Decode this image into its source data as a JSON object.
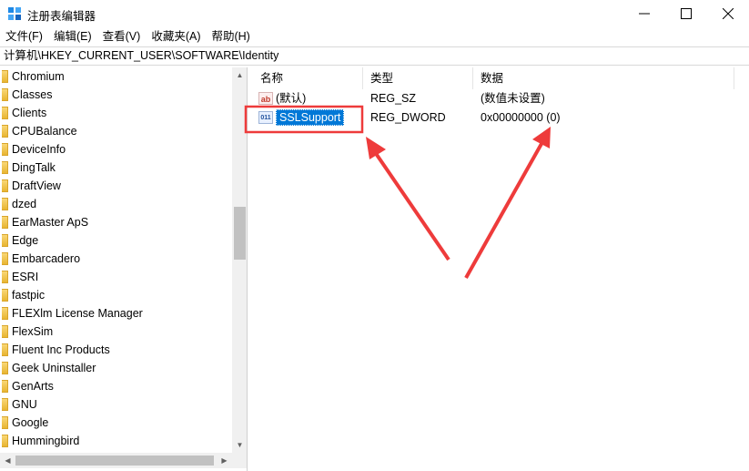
{
  "window": {
    "title": "注册表编辑器"
  },
  "menu": {
    "items": [
      "文件(F)",
      "编辑(E)",
      "查看(V)",
      "收藏夹(A)",
      "帮助(H)"
    ]
  },
  "address": {
    "path": "计算机\\HKEY_CURRENT_USER\\SOFTWARE\\Identity"
  },
  "tree": {
    "items": [
      "Chromium",
      "Classes",
      "Clients",
      "CPUBalance",
      "DeviceInfo",
      "DingTalk",
      "DraftView",
      "dzed",
      "EarMaster ApS",
      "Edge",
      "Embarcadero",
      "ESRI",
      "fastpic",
      "FLEXlm License Manager",
      "FlexSim",
      "Fluent Inc Products",
      "Geek Uninstaller",
      "GenArts",
      "GNU",
      "Google",
      "Hummingbird"
    ]
  },
  "values": {
    "headers": {
      "name": "名称",
      "type": "类型",
      "data": "数据"
    },
    "rows": [
      {
        "icon": "string-value-icon",
        "name": "(默认)",
        "type": "REG_SZ",
        "data": "(数值未设置)"
      },
      {
        "icon": "binary-value-icon",
        "name": "SSLSupport",
        "type": "REG_DWORD",
        "data": "0x00000000 (0)"
      }
    ]
  },
  "annotation": {
    "color": "#ee3b3b"
  }
}
